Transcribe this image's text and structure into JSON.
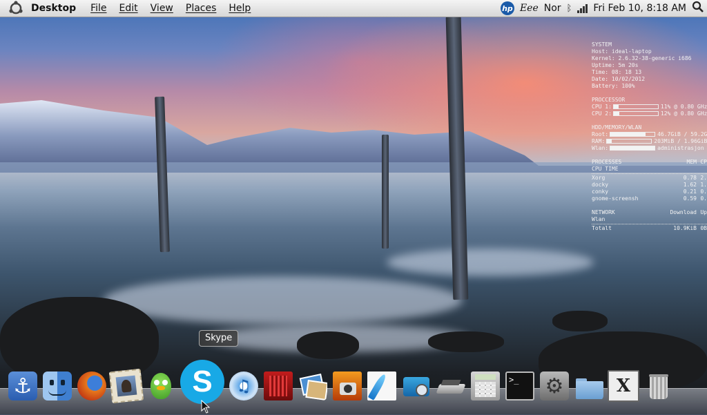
{
  "menubar": {
    "app_title": "Desktop",
    "menus": [
      "File",
      "Edit",
      "View",
      "Places",
      "Help"
    ],
    "keyboard_layout": "Nor",
    "clock": "Fri Feb 10,  8:18 AM"
  },
  "conky": {
    "system": {
      "heading": "SYSTEM",
      "lines": [
        "Host: ideal-laptop",
        "Kernel: 2.6.32-38-generic i686",
        "Uptime: 5m 20s",
        "Time: 08: 18 13",
        "Date: 10/02/2012",
        "Battery: 100%"
      ]
    },
    "processor": {
      "heading": "PROCCESSOR",
      "cpu1_label": "CPU 1:",
      "cpu1_text": "11% @ 0.80 GHz",
      "cpu1_pct": 11,
      "cpu2_label": "CPU 2:",
      "cpu2_text": "12% @ 0.80 GHz",
      "cpu2_pct": 12
    },
    "storage": {
      "heading": "HDD/MEMORY/WLAN",
      "root_label": "Root:",
      "root_text": "46.7GiB / 59.2GiB",
      "root_pct": 79,
      "ram_label": "RAM:",
      "ram_text": "203MiB / 1.96GiB",
      "ram_pct": 10,
      "wlan_label": "Wlan:",
      "wlan_text": "administrasjon (",
      "wlan_pct": 100
    },
    "processes": {
      "heading": "PROCESSES",
      "col_mem": "MEM",
      "col_cpu": "CP",
      "subheading": "CPU TIME",
      "rows": [
        {
          "name": "Xorg",
          "mem": "0.78",
          "cpu": "2."
        },
        {
          "name": "docky",
          "mem": "1.62",
          "cpu": "1."
        },
        {
          "name": "conky",
          "mem": "0.21",
          "cpu": "0."
        },
        {
          "name": "gnome-screensh",
          "mem": "0.59",
          "cpu": "0."
        }
      ]
    },
    "network": {
      "heading": "NETWORK",
      "col_down": "Download",
      "col_up": "Up",
      "iface": "Wlan",
      "total_label": "Totalt",
      "down": "10.9KiB",
      "up": "0B"
    }
  },
  "dock": {
    "tooltip": "Skype",
    "items": [
      "anchor",
      "finder",
      "firefox",
      "mail",
      "pidgin",
      "skype",
      "itunes",
      "dvd-player",
      "iphoto",
      "photo-booth",
      "quill",
      "photo-camera",
      "scanner",
      "calculator",
      "terminal",
      "system-preferences",
      "folder",
      "x-chat",
      "trash"
    ]
  },
  "colors": {
    "accent": "#1a5aa8",
    "skype_blue": "#18a9e6",
    "menubar_top": "#f4f4f4"
  }
}
